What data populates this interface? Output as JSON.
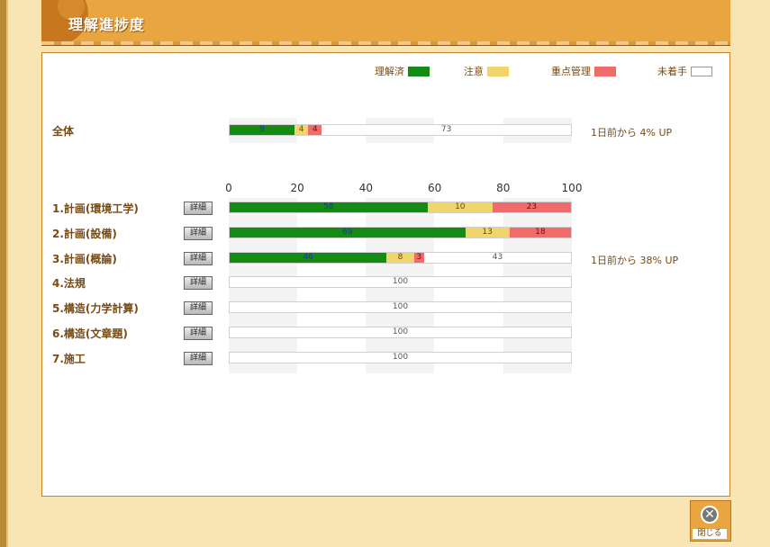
{
  "header": {
    "title": "理解進捗度"
  },
  "legend": [
    {
      "label": "理解済",
      "color": "#158a14"
    },
    {
      "label": "注意",
      "color": "#efd56a"
    },
    {
      "label": "重点管理",
      "color": "#f26a6a"
    },
    {
      "label": "未着手",
      "color": "#ffffff"
    }
  ],
  "overall": {
    "label": "全体",
    "segments": [
      {
        "kind": "done",
        "value": 19,
        "text": "9"
      },
      {
        "kind": "caution",
        "value": 4,
        "text": "4"
      },
      {
        "kind": "focus",
        "value": 4,
        "text": "4"
      },
      {
        "kind": "untouched",
        "value": 73,
        "text": "73"
      }
    ],
    "change": "1日前から 4% UP"
  },
  "axis": {
    "ticks": [
      "0",
      "20",
      "40",
      "60",
      "80",
      "100"
    ]
  },
  "subjects": [
    {
      "label": "1.計画(環境工学)",
      "detail": "詳細",
      "segments": [
        {
          "kind": "done",
          "value": 58,
          "text": "58"
        },
        {
          "kind": "caution",
          "value": 19,
          "text": "10"
        },
        {
          "kind": "focus",
          "value": 23,
          "text": "23"
        }
      ],
      "change": ""
    },
    {
      "label": "2.計画(設備)",
      "detail": "詳細",
      "segments": [
        {
          "kind": "done",
          "value": 69,
          "text": "69"
        },
        {
          "kind": "caution",
          "value": 13,
          "text": "13"
        },
        {
          "kind": "focus",
          "value": 18,
          "text": "18"
        }
      ],
      "change": ""
    },
    {
      "label": "3.計画(概論)",
      "detail": "詳細",
      "segments": [
        {
          "kind": "done",
          "value": 46,
          "text": "46"
        },
        {
          "kind": "caution",
          "value": 8,
          "text": "8"
        },
        {
          "kind": "focus",
          "value": 3,
          "text": "3"
        },
        {
          "kind": "untouched",
          "value": 43,
          "text": "43"
        }
      ],
      "change": "1日前から 38% UP"
    },
    {
      "label": "4.法規",
      "detail": "詳細",
      "segments": [
        {
          "kind": "untouched",
          "value": 100,
          "text": "100"
        }
      ],
      "change": ""
    },
    {
      "label": "5.構造(力学計算)",
      "detail": "詳細",
      "segments": [
        {
          "kind": "untouched",
          "value": 100,
          "text": "100"
        }
      ],
      "change": ""
    },
    {
      "label": "6.構造(文章題)",
      "detail": "詳細",
      "segments": [
        {
          "kind": "untouched",
          "value": 100,
          "text": "100"
        }
      ],
      "change": ""
    },
    {
      "label": "7.施工",
      "detail": "詳細",
      "segments": [
        {
          "kind": "untouched",
          "value": 100,
          "text": "100"
        }
      ],
      "change": ""
    }
  ],
  "close": {
    "label": "閉じる",
    "icon": "close-icon"
  }
}
